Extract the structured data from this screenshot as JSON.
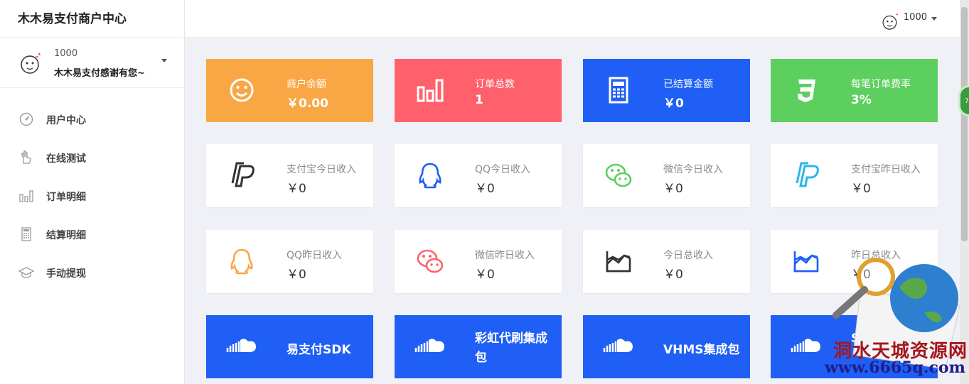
{
  "sidebar": {
    "brand": "木木易支付商户中心",
    "profile": {
      "uid": "1000",
      "message": "木木易支付感谢有您~"
    },
    "nav": [
      {
        "label": "用户中心",
        "icon": "dashboard-icon"
      },
      {
        "label": "在线测试",
        "icon": "hand-icon"
      },
      {
        "label": "订单明细",
        "icon": "bar-chart-icon"
      },
      {
        "label": "结算明细",
        "icon": "calculator-icon"
      },
      {
        "label": "手动提现",
        "icon": "graduation-cap-icon"
      }
    ]
  },
  "topbar": {
    "uid": "1000"
  },
  "stats_top": [
    {
      "label": "商户余额",
      "value": "￥0.00",
      "icon": "smile-icon",
      "color": "#f9a744"
    },
    {
      "label": "订单总数",
      "value": "1",
      "icon": "bar-chart-icon",
      "color": "#fe616c"
    },
    {
      "label": "已结算金额",
      "value": "￥0",
      "icon": "calculator-icon",
      "color": "#1f5ff5"
    },
    {
      "label": "每笔订单费率",
      "value": "3%",
      "icon": "css3-icon",
      "color": "#5dcf5f"
    }
  ],
  "stats_today": [
    {
      "label": "支付宝今日收入",
      "value": "￥0",
      "icon": "paypal-icon"
    },
    {
      "label": "QQ今日收入",
      "value": "￥0",
      "icon": "qq-icon"
    },
    {
      "label": "微信今日收入",
      "value": "￥0",
      "icon": "wechat-icon"
    },
    {
      "label": "支付宝昨日收入",
      "value": "￥0",
      "icon": "paypal-icon"
    }
  ],
  "stats_yesterday": [
    {
      "label": "QQ昨日收入",
      "value": "￥0",
      "icon": "qq-icon"
    },
    {
      "label": "微信昨日收入",
      "value": "￥0",
      "icon": "wechat-icon"
    },
    {
      "label": "今日总收入",
      "value": "￥0",
      "icon": "area-chart-icon"
    },
    {
      "label": "昨日总收入",
      "value": "￥0",
      "icon": "area-chart-icon"
    }
  ],
  "downloads": [
    {
      "title": "易支付SDK",
      "icon": "soundcloud-icon"
    },
    {
      "title": "彩虹代刷集成包",
      "icon": "soundcloud-icon"
    },
    {
      "title": "VHMS集成包",
      "icon": "soundcloud-icon"
    },
    {
      "title": "SWAP集成包",
      "icon": "soundcloud-icon"
    }
  ],
  "float_ball": "70",
  "watermark": {
    "text": "洞水天城资源网",
    "url": "www.6665q.com"
  }
}
